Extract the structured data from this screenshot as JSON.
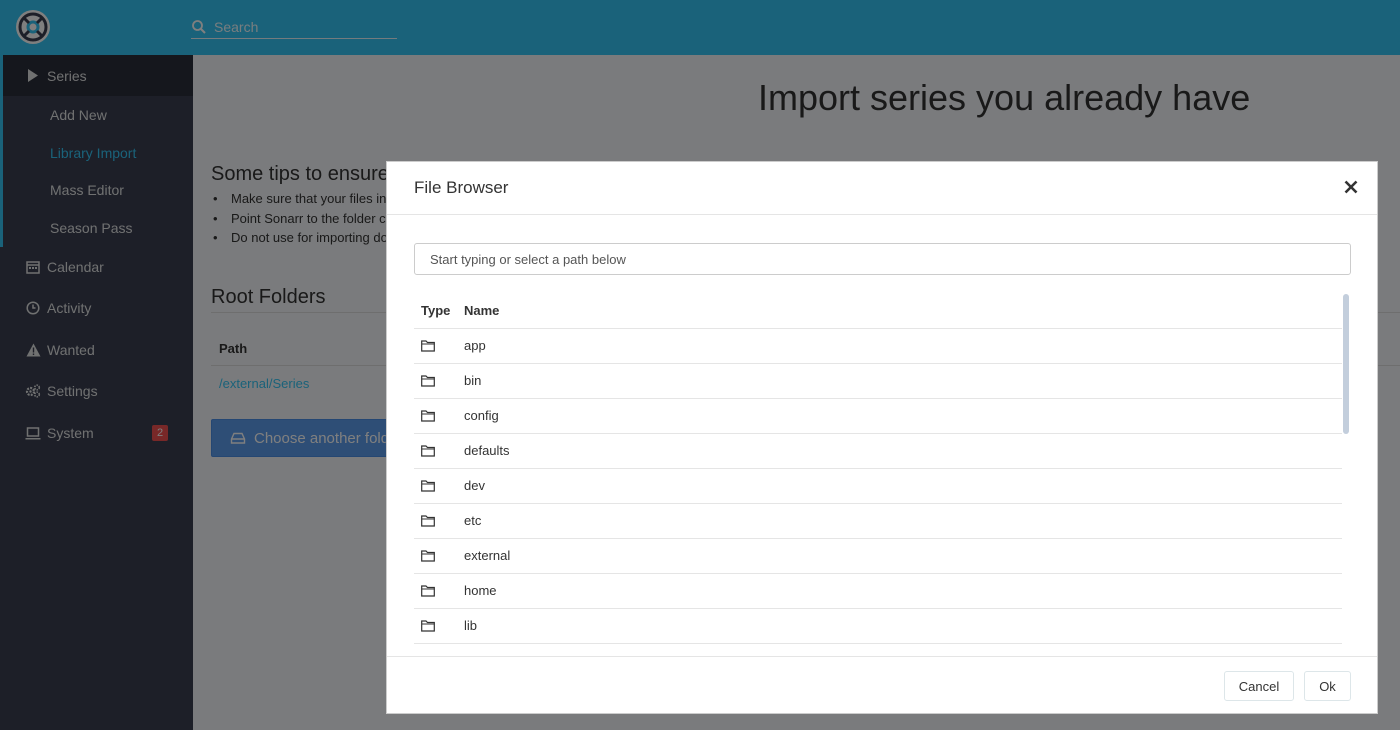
{
  "app": {
    "search": {
      "placeholder": "Search"
    }
  },
  "sidebar": {
    "items": [
      {
        "label": "Series",
        "icon": "play-icon"
      },
      {
        "label": "Calendar",
        "icon": "calendar-icon"
      },
      {
        "label": "Activity",
        "icon": "clock-icon"
      },
      {
        "label": "Wanted",
        "icon": "warning-icon"
      },
      {
        "label": "Settings",
        "icon": "gears-icon"
      },
      {
        "label": "System",
        "icon": "laptop-icon",
        "badge": "2"
      }
    ],
    "series_subitems": [
      "Add New",
      "Library Import",
      "Mass Editor",
      "Season Pass"
    ],
    "active_subitem": "Library Import"
  },
  "page": {
    "title": "Import series you already have",
    "tips_title": "Some tips to ensure t",
    "tips": [
      "Make sure that your files inc",
      "Point Sonarr to the folder co",
      "Do not use for importing do"
    ],
    "root_folders_title": "Root Folders",
    "path_header": "Path",
    "root_path": "/external/Series",
    "choose_button": "Choose another fold"
  },
  "modal": {
    "title": "File Browser",
    "path_placeholder": "Start typing or select a path below",
    "columns": [
      "Type",
      "Name"
    ],
    "folders": [
      "app",
      "bin",
      "config",
      "defaults",
      "dev",
      "etc",
      "external",
      "home",
      "lib"
    ],
    "cancel_label": "Cancel",
    "ok_label": "Ok"
  },
  "colors": {
    "accent": "#35c5f4",
    "sidebar_bg": "#3a3f51",
    "primary_button": "#5d9cec",
    "badge": "#f05050"
  }
}
